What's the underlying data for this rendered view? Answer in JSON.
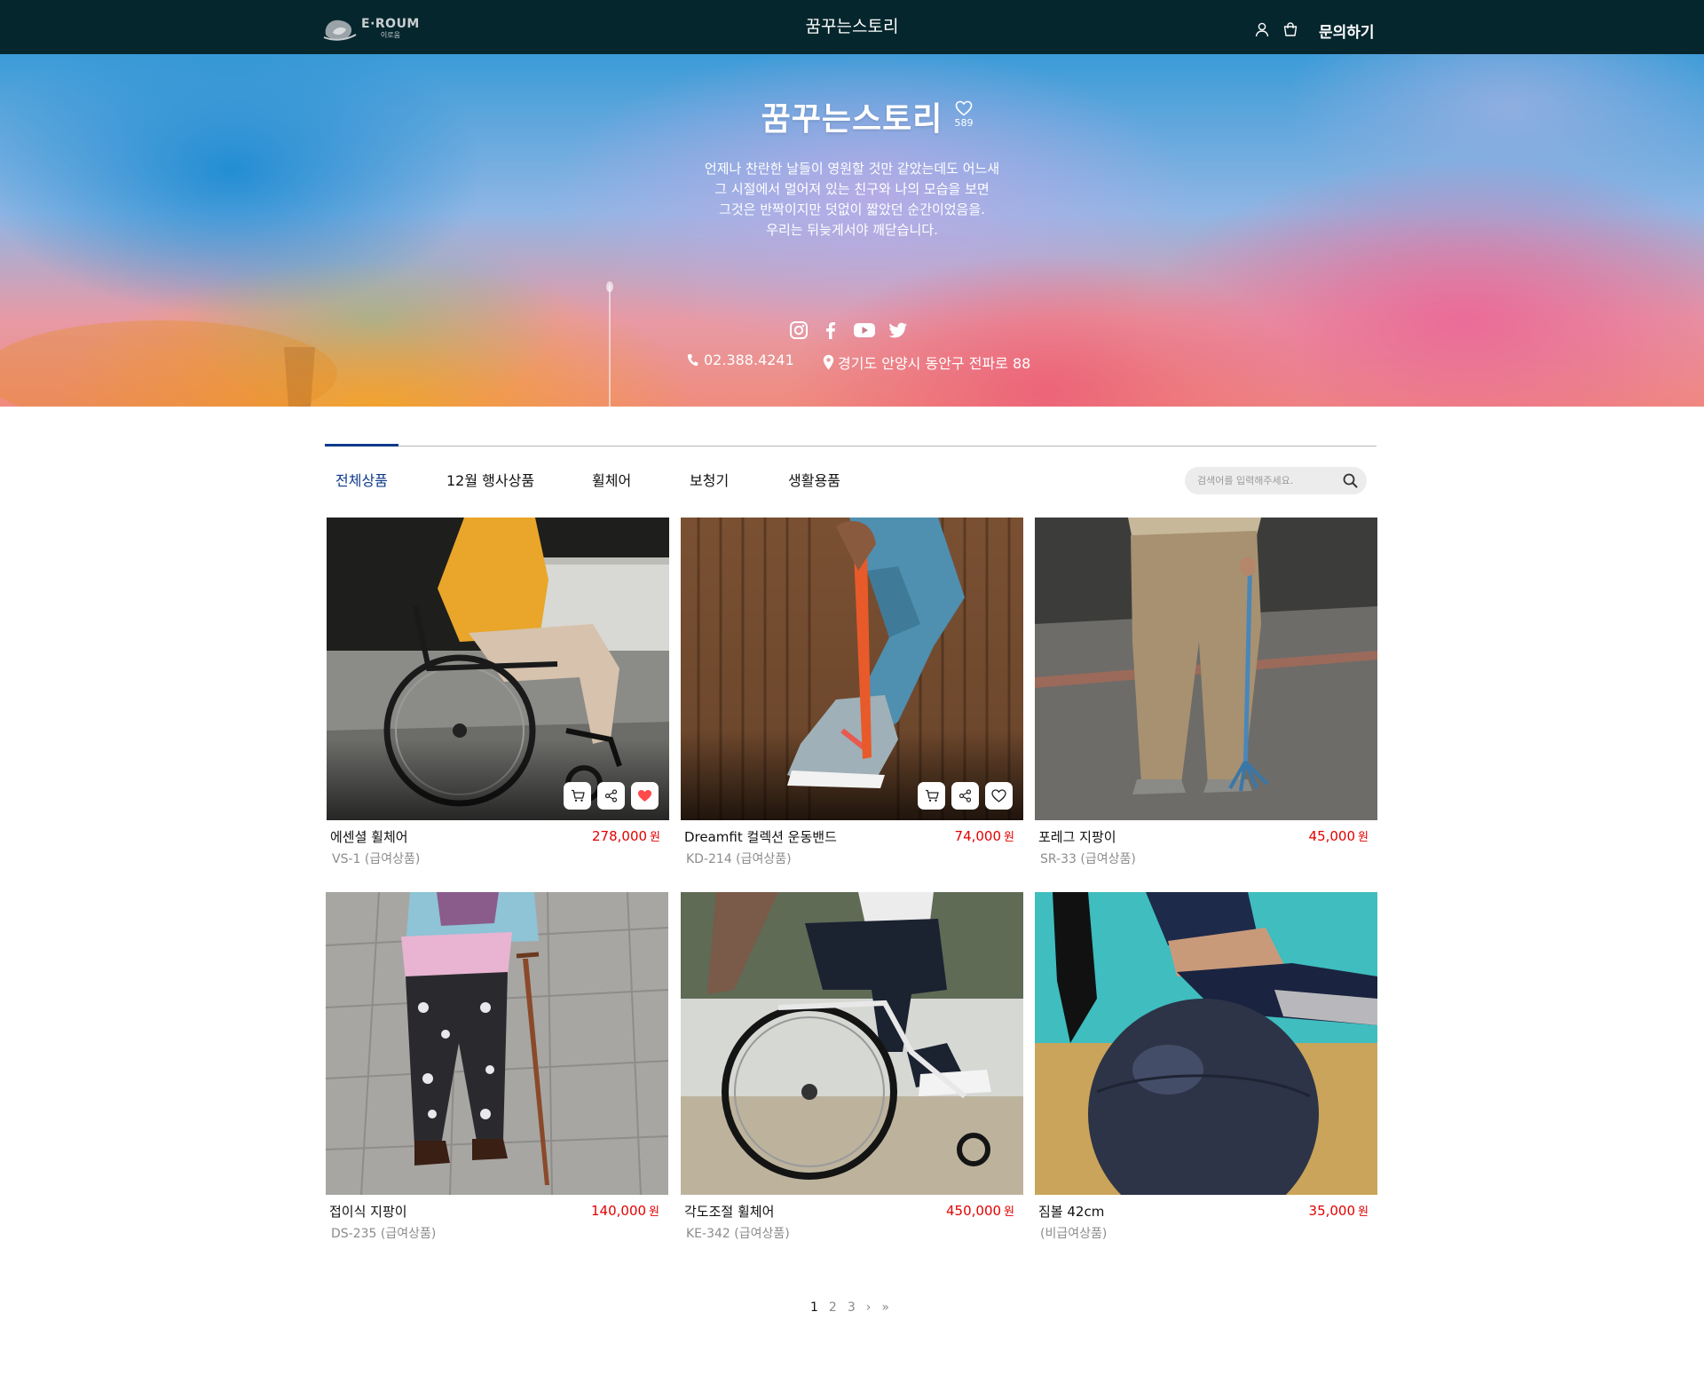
{
  "header": {
    "logo_text": "E·ROUM",
    "logo_sub": "이로움",
    "title": "꿈꾸는스토리",
    "inquiry_label": "문의하기",
    "icons": [
      "user-icon",
      "shopping-bag-icon"
    ]
  },
  "hero": {
    "store_name": "꿈꾸는스토리",
    "like_count": "589",
    "description": [
      "언제나 찬란한 날들이 영원할 것만 같았는데도 어느새",
      "그 시절에서 멀어져 있는 친구와 나의 모습을 보면",
      "그것은 반짝이지만 덧없이 짧았던 순간이었음을.",
      "우리는 뒤늦게서야 깨닫습니다."
    ],
    "socials": [
      "instagram-icon",
      "facebook-icon",
      "youtube-icon",
      "twitter-icon"
    ],
    "phone": "02.388.4241",
    "address": "경기도 안양시 동안구 전파로 88"
  },
  "tabs": [
    {
      "label": "전체상품",
      "active": true
    },
    {
      "label": "12월 행사상품",
      "active": false
    },
    {
      "label": "휠체어",
      "active": false
    },
    {
      "label": "보청기",
      "active": false
    },
    {
      "label": "생활용품",
      "active": false
    }
  ],
  "search": {
    "placeholder": "검색어를 입력해주세요.",
    "value": ""
  },
  "products": [
    {
      "name": "에센셜 휠체어",
      "price": "278,000",
      "currency": "원",
      "code": "VS-1 (급여상품)",
      "liked": true,
      "show_actions": true
    },
    {
      "name": "Dreamfit 컬렉션 운동밴드",
      "price": "74,000",
      "currency": "원",
      "code": "KD-214 (급여상품)",
      "liked": false,
      "show_actions": true
    },
    {
      "name": "포레그 지팡이",
      "price": "45,000",
      "currency": "원",
      "code": "SR-33 (급여상품)",
      "liked": false,
      "show_actions": false
    },
    {
      "name": "접이식 지팡이",
      "price": "140,000",
      "currency": "원",
      "code": "DS-235 (급여상품)",
      "liked": false,
      "show_actions": false
    },
    {
      "name": "각도조절 휠체어",
      "price": "450,000",
      "currency": "원",
      "code": "KE-342 (급여상품)",
      "liked": false,
      "show_actions": false
    },
    {
      "name": "짐볼 42cm",
      "price": "35,000",
      "currency": "원",
      "code": "(비급여상품)",
      "liked": false,
      "show_actions": false
    }
  ],
  "pagination": {
    "pages": [
      "1",
      "2",
      "3"
    ],
    "current": "1",
    "next": "›",
    "last": "»"
  },
  "colors": {
    "topbar": "#06262d",
    "accent": "#0d3a8c",
    "price": "#e10000",
    "like": "#ff4a4a"
  }
}
